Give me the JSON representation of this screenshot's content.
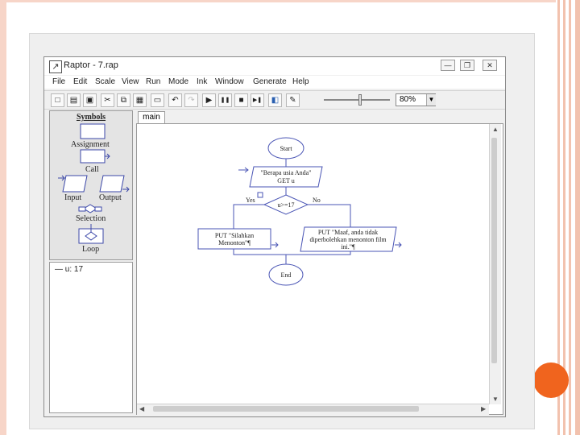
{
  "window": {
    "title": "Raptor - 7.rap",
    "app_icon": "raptor-icon",
    "minimize_glyph": "—",
    "restore_glyph": "❐",
    "close_glyph": "✕"
  },
  "menu": [
    "File",
    "Edit",
    "Scale",
    "View",
    "Run",
    "Mode",
    "Ink",
    "Window",
    "Generate",
    "Help"
  ],
  "toolbar": {
    "buttons": [
      {
        "icon": "new-file-icon",
        "glyph": "□"
      },
      {
        "icon": "open-folder-icon",
        "glyph": "▤"
      },
      {
        "icon": "save-icon",
        "glyph": "▣"
      },
      {
        "icon": "cut-icon",
        "glyph": "✂"
      },
      {
        "icon": "copy-icon",
        "glyph": "⧉"
      },
      {
        "icon": "paste-icon",
        "glyph": "▦"
      },
      {
        "icon": "print-icon",
        "glyph": "▭"
      },
      {
        "icon": "undo-icon",
        "glyph": "↶"
      },
      {
        "icon": "redo-icon",
        "glyph": "↷"
      },
      {
        "icon": "play-icon",
        "glyph": "▶"
      },
      {
        "icon": "pause-icon",
        "glyph": "❚❚"
      },
      {
        "icon": "stop-icon",
        "glyph": "■"
      },
      {
        "icon": "step-icon",
        "glyph": "▶❚"
      },
      {
        "icon": "test-server-icon",
        "glyph": "◧"
      },
      {
        "icon": "pen-icon",
        "glyph": "✎"
      }
    ],
    "speed_slider_value": 0.55,
    "zoom": "80%",
    "zoom_arrow": "▼"
  },
  "symbols": {
    "title": "Symbols",
    "items": [
      "Assignment",
      "Call",
      "Input",
      "Output",
      "Selection",
      "Loop"
    ]
  },
  "variables": [
    {
      "text": "u: 17",
      "prefix": "—"
    }
  ],
  "tabs": [
    "main"
  ],
  "flowchart": {
    "start": "Start",
    "input_text": "\"Berapa usia Anda\"",
    "input_var": "GET u",
    "condition": "u>=17",
    "yes_label": "Yes",
    "no_label": "No",
    "yes_box_line1": "PUT \"Silahkan",
    "yes_box_line2": "Menonton\"¶",
    "no_box_line1": "PUT \"Maaf, anda tidak",
    "no_box_line2": "diperbolehkan menonton film",
    "no_box_line3": "ini.\"¶",
    "end": "End"
  },
  "colors": {
    "flow_stroke": "#4a55b5",
    "slide_accent": "#f0641e",
    "slide_border": "#f2c2ae"
  }
}
